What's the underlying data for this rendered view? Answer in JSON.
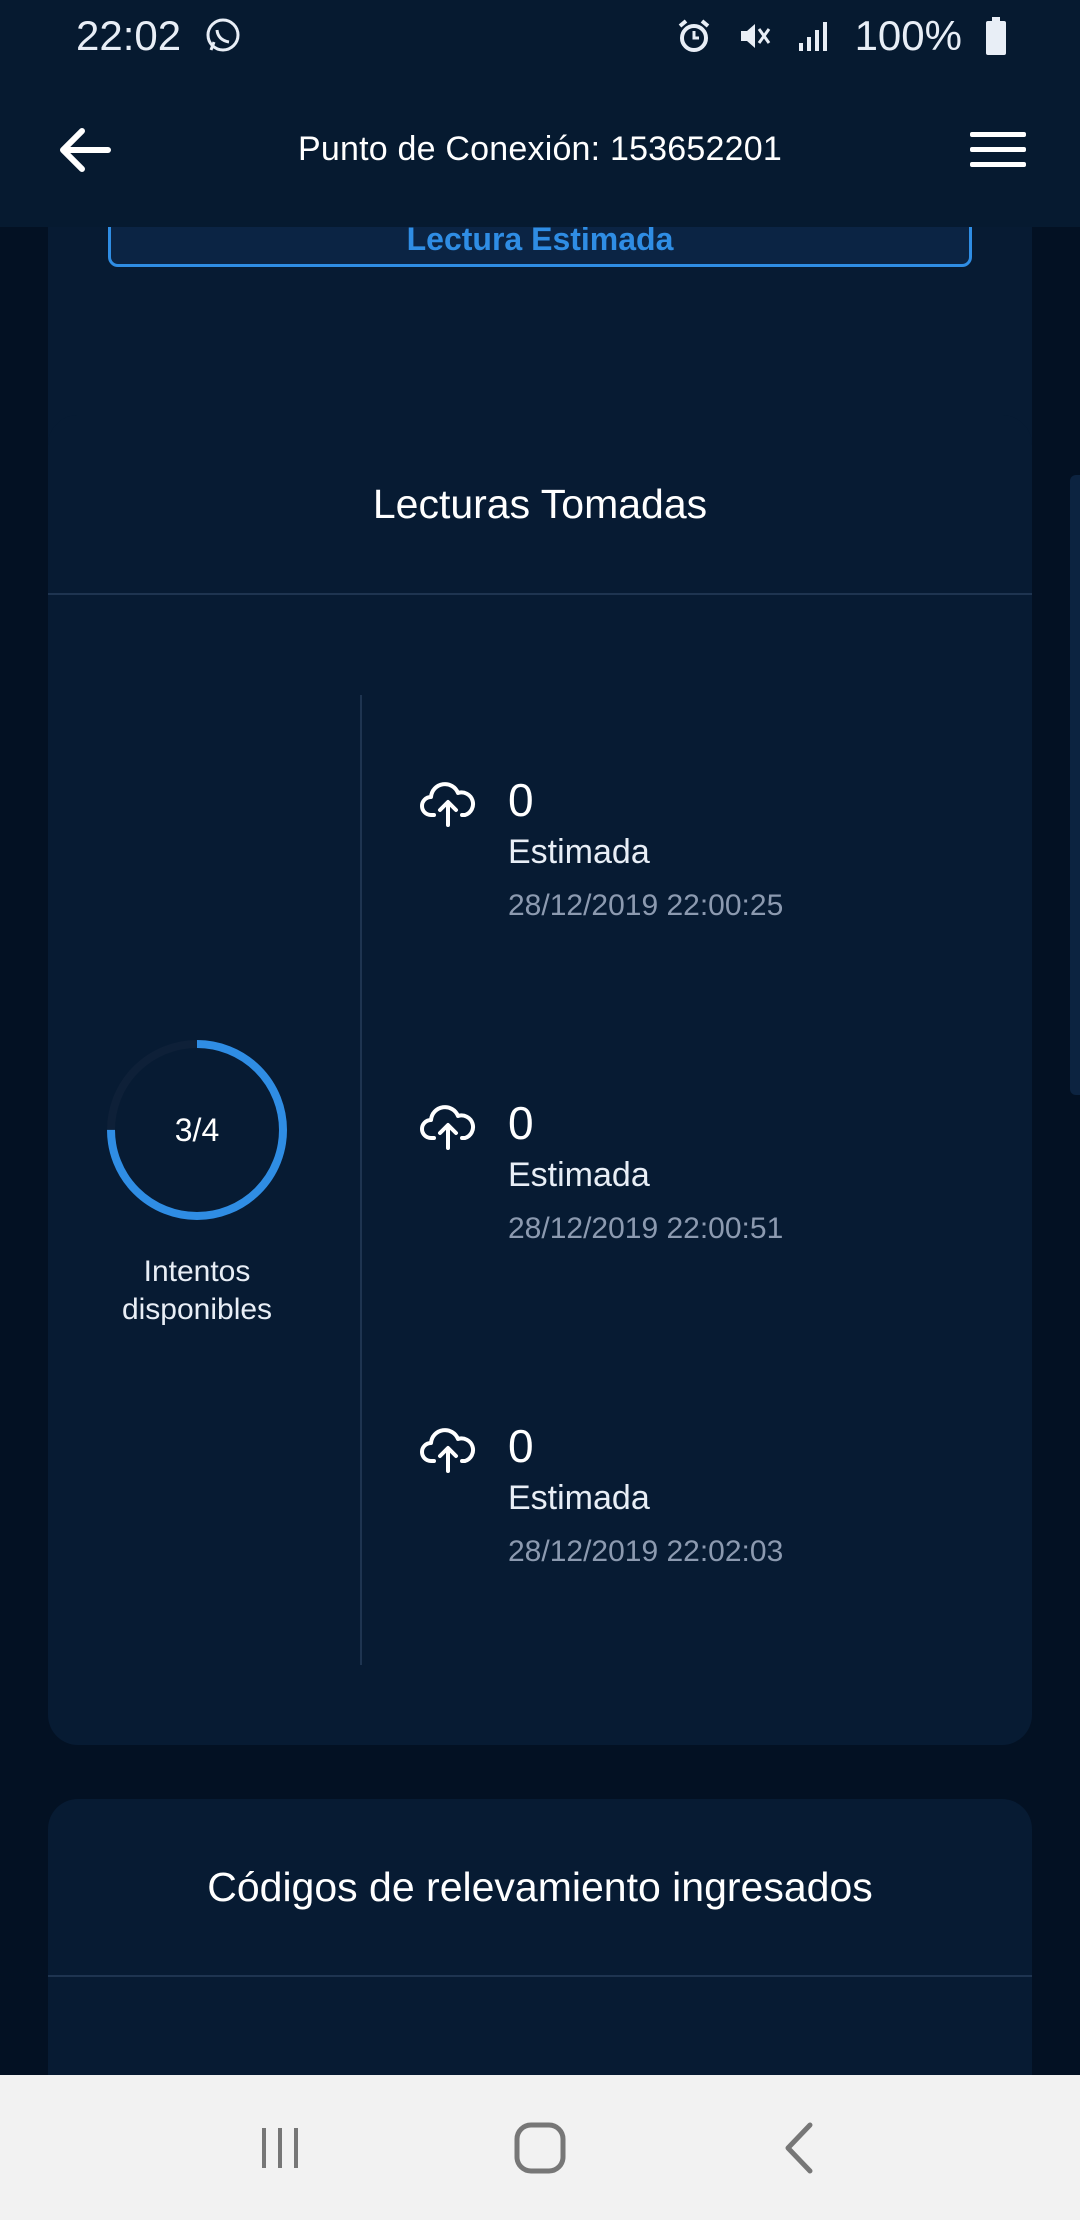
{
  "status_bar": {
    "time": "22:02",
    "battery": "100%",
    "icons": [
      "whatsapp-icon",
      "alarm-icon",
      "mute-icon",
      "signal-icon",
      "battery-icon"
    ]
  },
  "app_bar": {
    "title": "Punto de Conexión: 153652201",
    "icons": [
      "back-arrow-icon",
      "hamburger-menu-icon"
    ]
  },
  "top_card": {
    "estimated_button_label": "Lectura Estimada"
  },
  "readings_card": {
    "title": "Lecturas Tomadas",
    "attempts": {
      "value": "3/4",
      "label": "Intentos disponibles",
      "used": 3,
      "total": 4
    },
    "readings": [
      {
        "value": "0",
        "type": "Estimada",
        "date": "28/12/2019 22:00:25",
        "icon": "cloud-upload-icon"
      },
      {
        "value": "0",
        "type": "Estimada",
        "date": "28/12/2019 22:00:51",
        "icon": "cloud-upload-icon"
      },
      {
        "value": "0",
        "type": "Estimada",
        "date": "28/12/2019 22:02:03",
        "icon": "cloud-upload-icon"
      }
    ]
  },
  "codes_card": {
    "title": "Códigos de relevamiento ingresados"
  },
  "nav_bar": {
    "icons": [
      "recents-icon",
      "home-icon",
      "back-icon"
    ]
  },
  "colors": {
    "background": "#031123",
    "card": "#071b33",
    "accent": "#2f8de4",
    "muted_text": "#8c9ab0"
  }
}
